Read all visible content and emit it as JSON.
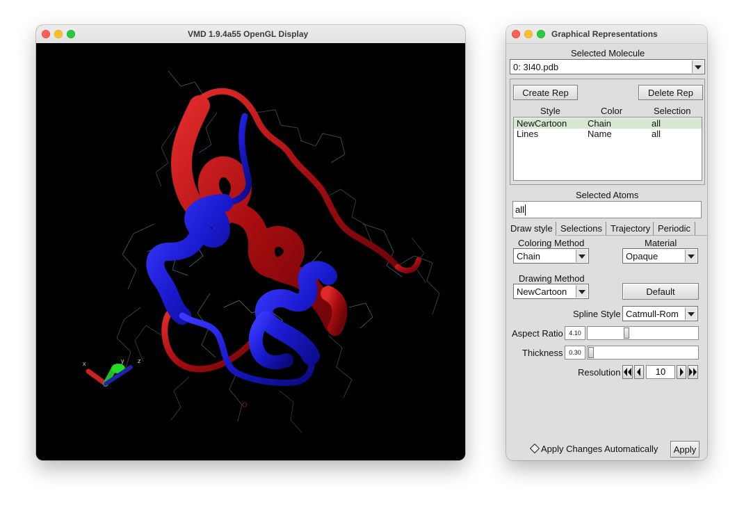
{
  "display_window": {
    "title": "VMD 1.9.4a55 OpenGL Display",
    "axes": {
      "x_label": "x",
      "y_label": "y",
      "z_label": "z"
    },
    "colors": {
      "background": "#000000",
      "chain_a": "#c0111a",
      "chain_b": "#1818c8"
    }
  },
  "reps_window": {
    "title": "Graphical Representations",
    "selected_molecule_label": "Selected Molecule",
    "selected_molecule_value": "0: 3I40.pdb",
    "create_rep_label": "Create Rep",
    "delete_rep_label": "Delete Rep",
    "columns": {
      "style": "Style",
      "color": "Color",
      "selection": "Selection"
    },
    "reps": [
      {
        "style": "NewCartoon",
        "color": "Chain",
        "selection": "all",
        "selected": true
      },
      {
        "style": "Lines",
        "color": "Name",
        "selection": "all",
        "selected": false
      }
    ],
    "selected_atoms_label": "Selected Atoms",
    "selected_atoms_value": "all",
    "tabs": [
      "Draw style",
      "Selections",
      "Trajectory",
      "Periodic"
    ],
    "active_tab": "Draw style",
    "coloring_method_label": "Coloring Method",
    "coloring_method_value": "Chain",
    "material_label": "Material",
    "material_value": "Opaque",
    "drawing_method_label": "Drawing Method",
    "drawing_method_value": "NewCartoon",
    "default_label": "Default",
    "spline_style_label": "Spline Style",
    "spline_style_value": "Catmull-Rom",
    "aspect_ratio_label": "Aspect Ratio",
    "aspect_ratio_value": "4.10",
    "aspect_ratio_slider_fraction": 0.34,
    "thickness_label": "Thickness",
    "thickness_value": "0.30",
    "thickness_slider_fraction": 0.0,
    "resolution_label": "Resolution",
    "resolution_value": "10",
    "apply_auto_label": "Apply Changes Automatically",
    "apply_label": "Apply"
  }
}
